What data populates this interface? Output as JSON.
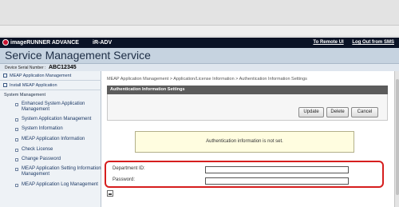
{
  "browser": {
    "address_value": "",
    "dropdown_arrow": "▼"
  },
  "header": {
    "brand": "imageRUNNER ADVANCE",
    "model": "iR-ADV",
    "links": [
      "To Remote UI",
      "Log Out from SMS"
    ],
    "title": "Service Management Service",
    "device_serial_label": "Device Serial Number :",
    "device_serial_value": "ABC12345"
  },
  "sidebar": {
    "top_items": [
      "MEAP Application Management",
      "Install MEAP Application"
    ],
    "section_heading": "System Management",
    "sub_items": [
      "Enhanced System Application Management",
      "System Application Management",
      "System Information",
      "MEAP Application Information",
      "Check License",
      "Change Password",
      "MEAP Application Setting Information Management",
      "MEAP Application Log Management"
    ]
  },
  "main": {
    "breadcrumb": "MEAP Application Management > Application/License Information > Authentication Information Settings",
    "panel_title": "Authentication Information Settings",
    "buttons": {
      "update": "Update",
      "delete": "Delete",
      "cancel": "Cancel"
    },
    "message": "Authentication information is not set.",
    "department_label": "Department ID:",
    "password_label": "Password:",
    "department_value": "",
    "password_value": ""
  },
  "colors": {
    "accent": "#d61e1e",
    "header_dark": "#0a1326",
    "panel_head": "#5c5c5c"
  }
}
